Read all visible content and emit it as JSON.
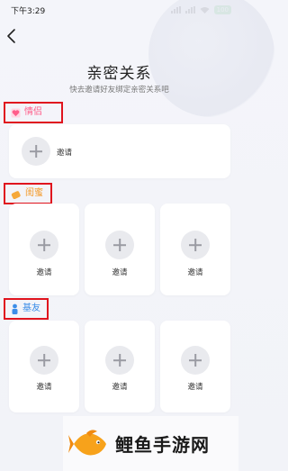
{
  "status_bar": {
    "time": "下午3:29",
    "battery": "100"
  },
  "header": {
    "title": "亲密关系",
    "subtitle": "快去邀请好友绑定亲密关系吧"
  },
  "sections": [
    {
      "label": "情侣",
      "slots": [
        {
          "label": "邀请"
        }
      ]
    },
    {
      "label": "闺蜜",
      "slots": [
        {
          "label": "邀请"
        },
        {
          "label": "邀请"
        },
        {
          "label": "邀请"
        }
      ]
    },
    {
      "label": "基友",
      "slots": [
        {
          "label": "邀请"
        },
        {
          "label": "邀请"
        },
        {
          "label": "邀请"
        }
      ]
    }
  ],
  "watermark": {
    "text": "鲤鱼手游网"
  }
}
